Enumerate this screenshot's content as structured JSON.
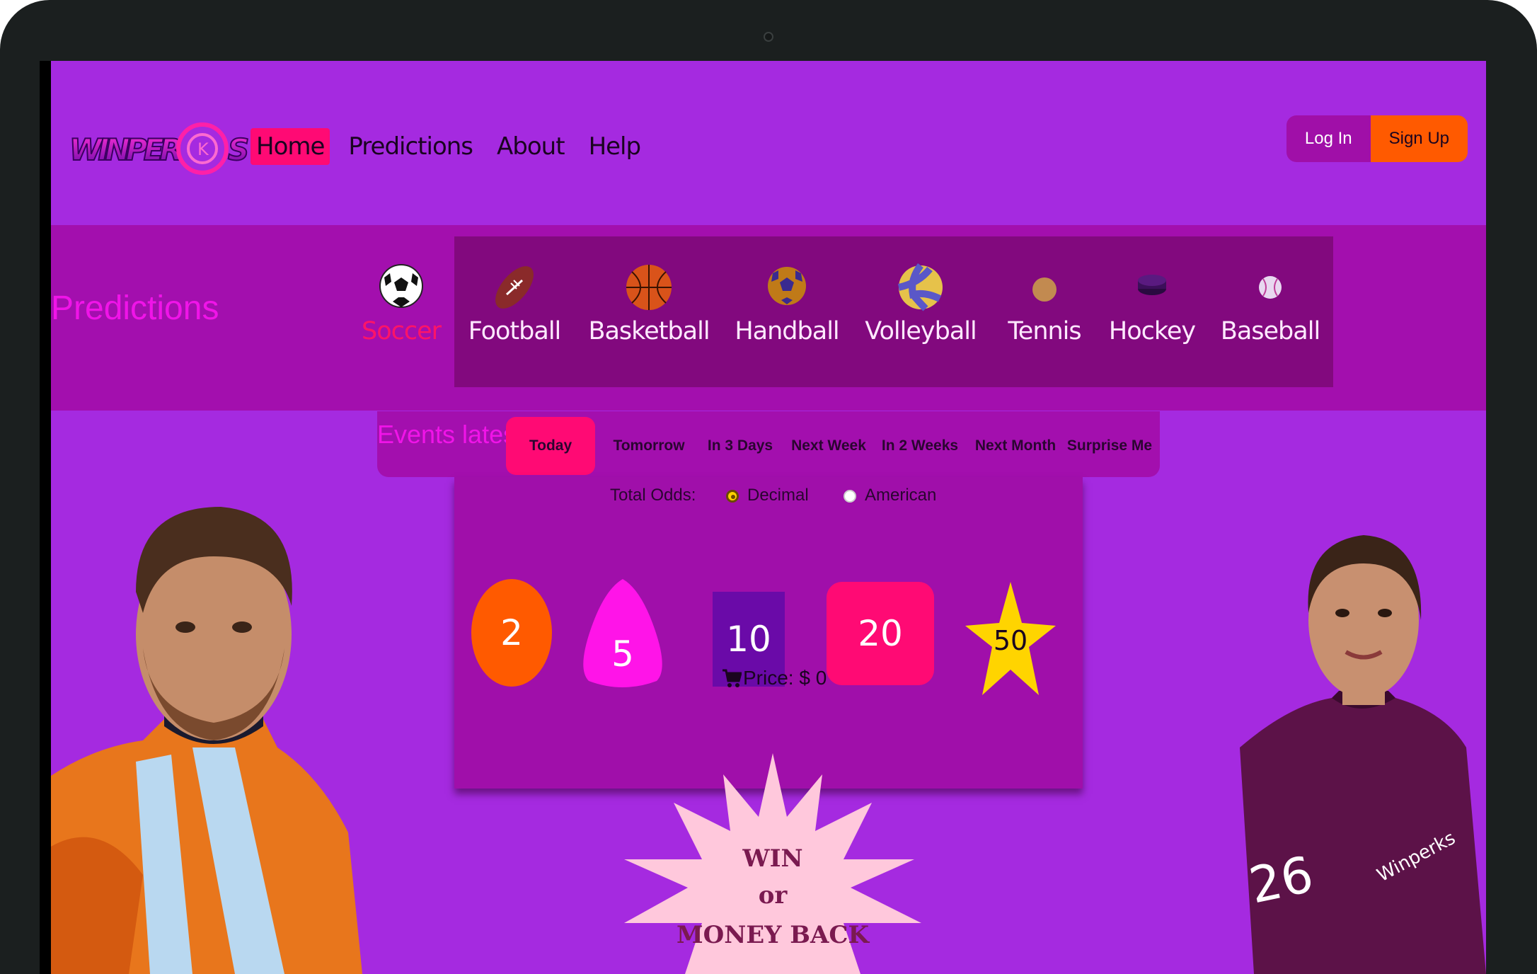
{
  "header": {
    "logo_text": "WINPERKS",
    "nav": [
      "Home",
      "Predictions",
      "About",
      "Help"
    ],
    "login_label": "Log In",
    "signup_label": "Sign Up"
  },
  "predictions": {
    "title": "Predictions",
    "sports": [
      {
        "label": "Soccer",
        "icon": "soccer-ball-icon",
        "active": true
      },
      {
        "label": "Football",
        "icon": "american-football-icon"
      },
      {
        "label": "Basketball",
        "icon": "basketball-icon"
      },
      {
        "label": "Handball",
        "icon": "handball-icon"
      },
      {
        "label": "Volleyball",
        "icon": "volleyball-icon"
      },
      {
        "label": "Tennis",
        "icon": "tennis-ball-icon"
      },
      {
        "label": "Hockey",
        "icon": "hockey-puck-icon"
      },
      {
        "label": "Baseball",
        "icon": "baseball-icon"
      }
    ]
  },
  "events": {
    "title": "Events latest",
    "tabs": [
      "Today",
      "Tomorrow",
      "In 3 Days",
      "Next Week",
      "In 2 Weeks",
      "Next Month",
      "Surprise Me"
    ],
    "active_tab": "Today"
  },
  "odds": {
    "label": "Total Odds:",
    "options": [
      "Decimal",
      "American"
    ],
    "selected": "Decimal",
    "values": [
      "2",
      "5",
      "10",
      "20",
      "50"
    ],
    "price_label": "Price: $ 0"
  },
  "promo": {
    "line1": "WIN",
    "line2": "or",
    "line3": "MONEY BACK"
  },
  "jersey_text": "Winperks",
  "jersey_number": "26",
  "colors": {
    "page_bg": "#a52ae0",
    "band_bg": "#a30fae",
    "accent_pink": "#ff0a74",
    "accent_orange": "#ff5a00"
  }
}
